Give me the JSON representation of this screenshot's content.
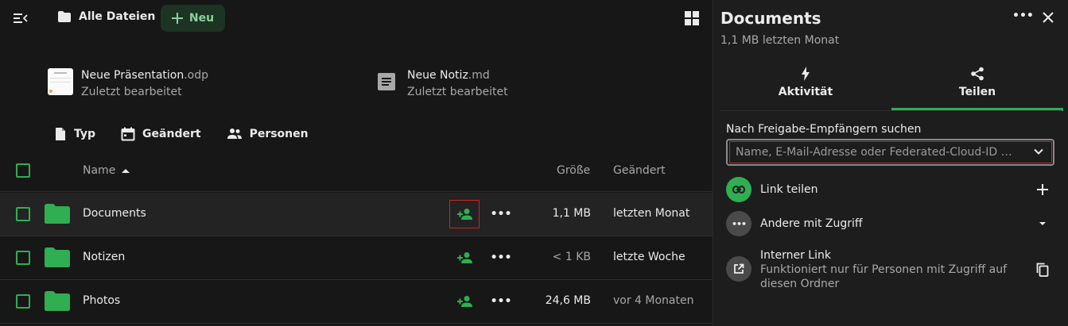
{
  "topbar": {
    "breadcrumb": "Alle Dateien",
    "new_label": "Neu"
  },
  "recent": [
    {
      "name": "Neue Präsentation",
      "ext": ".odp",
      "sub": "Zuletzt bearbeitet"
    },
    {
      "name": "Neue Notiz",
      "ext": ".md",
      "sub": "Zuletzt bearbeitet"
    }
  ],
  "filters": {
    "type": "Typ",
    "modified": "Geändert",
    "people": "Personen"
  },
  "table": {
    "col_name": "Name",
    "col_size": "Größe",
    "col_modified": "Geändert",
    "rows": [
      {
        "name": "Documents",
        "size": "1,1 MB",
        "modified": "letzten Monat"
      },
      {
        "name": "Notizen",
        "size": "< 1 KB",
        "modified": "letzte Woche"
      },
      {
        "name": "Photos",
        "size": "24,6 MB",
        "modified": "vor 4 Monaten"
      }
    ]
  },
  "sidebar": {
    "title": "Documents",
    "subtitle": "1,1 MB letzten Monat",
    "tabs": [
      {
        "label": "Aktivität"
      },
      {
        "label": "Teilen"
      }
    ],
    "search_label": "Nach Freigabe-Empfängern suchen",
    "search_placeholder": "Name, E-Mail-Adresse oder Federated-Cloud-ID …",
    "share_link": "Link teilen",
    "others_access": "Andere mit Zugriff",
    "internal_link": "Interner Link",
    "internal_desc": "Funktioniert nur für Personen mit Zugriff auf diesen Ordner"
  },
  "colors": {
    "accent": "#2fae52",
    "highlight": "#c1272d",
    "background": "#171717",
    "sidebar_bg": "#1d1d1d"
  }
}
